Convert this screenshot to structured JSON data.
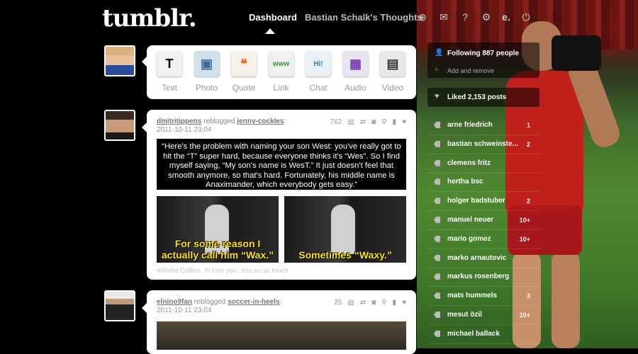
{
  "header": {
    "logo": "tumblr.",
    "nav_dashboard": "Dashboard",
    "nav_blog": "Bastian Schalk's Thoughts"
  },
  "composer": {
    "types": [
      {
        "label": "Text",
        "glyph": "T",
        "color": "#f0f0f0",
        "fg": "#000"
      },
      {
        "label": "Photo",
        "glyph": "▣",
        "color": "#cfe0ea",
        "fg": "#3a6a9a"
      },
      {
        "label": "Quote",
        "glyph": "❝",
        "color": "#f4f0e8",
        "fg": "#e07020"
      },
      {
        "label": "Link",
        "glyph": "www",
        "color": "#f0f0f0",
        "fg": "#2a9a2a"
      },
      {
        "label": "Chat",
        "glyph": "Hi!",
        "color": "#e8f0f6",
        "fg": "#3a7ac0"
      },
      {
        "label": "Audio",
        "glyph": "▦",
        "color": "#e8e4f0",
        "fg": "#7a3ab0"
      },
      {
        "label": "Video",
        "glyph": "▤",
        "color": "#e8e8e8",
        "fg": "#333"
      }
    ]
  },
  "posts": [
    {
      "user": "dmitritippens",
      "action": "reblogged",
      "source": "jenny-cockles",
      "date": "2011-10-11 23:04",
      "notes": "762",
      "quote": "“Here's the problem with naming your son West: you've really got to hit the “T” super hard, because everyone thinks it's “Wes”. So I find myself saying, “My son's name is WesT.” It just doesn't feel that smooth anymore, so that's hard. Fortunately, his middle name is Anaximander, which everybody gets easy.”",
      "gif_captions": [
        "For some reason I actually call him “Wax.”",
        "Sometimes “Waxy.”"
      ],
      "tags": [
        "#Misha Collins",
        "#i love you",
        "#so so so much"
      ]
    },
    {
      "user": "elnino9fan",
      "action": "reblogged",
      "source": "soccer-in-heels",
      "date": "2011-10-11 23:04",
      "notes": "25"
    }
  ],
  "sidebar": {
    "following": "Following 887 people",
    "add_remove": "Add and remove",
    "liked": "Liked 2,153 posts",
    "tags": [
      {
        "name": "arne friedrich",
        "count": "1"
      },
      {
        "name": "bastian schweinste...",
        "count": "2"
      },
      {
        "name": "clemens fritz",
        "count": ""
      },
      {
        "name": "hertha bsc",
        "count": ""
      },
      {
        "name": "holger badstuber",
        "count": "2"
      },
      {
        "name": "manuel neuer",
        "count": "10+"
      },
      {
        "name": "mario gomez",
        "count": "10+"
      },
      {
        "name": "marko arnautovic",
        "count": ""
      },
      {
        "name": "markus rosenberg",
        "count": ""
      },
      {
        "name": "mats hummels",
        "count": "3"
      },
      {
        "name": "mesut özil",
        "count": "10+"
      },
      {
        "name": "michael ballack",
        "count": ""
      }
    ]
  }
}
